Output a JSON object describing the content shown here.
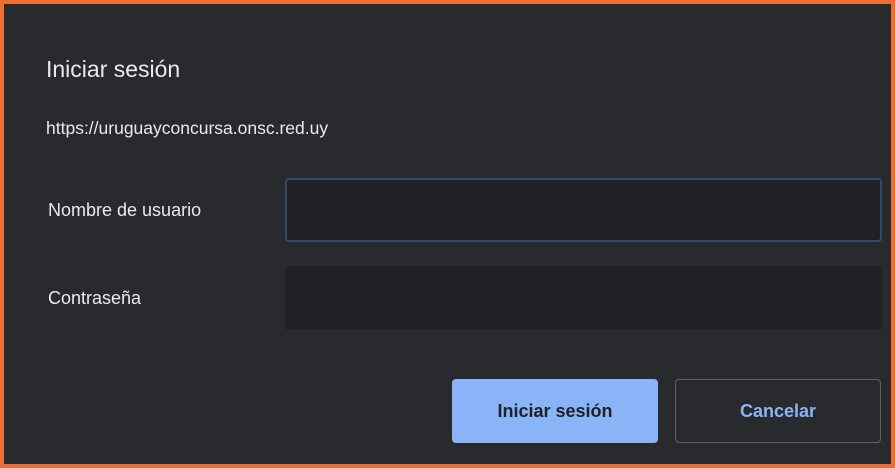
{
  "dialog": {
    "title": "Iniciar sesión",
    "origin": "https://uruguayconcursa.onsc.red.uy",
    "username_label": "Nombre de usuario",
    "username_value": "",
    "password_label": "Contraseña",
    "password_value": "",
    "submit_label": "Iniciar sesión",
    "cancel_label": "Cancelar"
  },
  "colors": {
    "frame_border": "#ea6f35",
    "dialog_background": "#292a2d",
    "input_background": "#202124",
    "focus_border": "#364a6a",
    "primary_button": "#8ab4f8",
    "text": "#e8eaed"
  }
}
